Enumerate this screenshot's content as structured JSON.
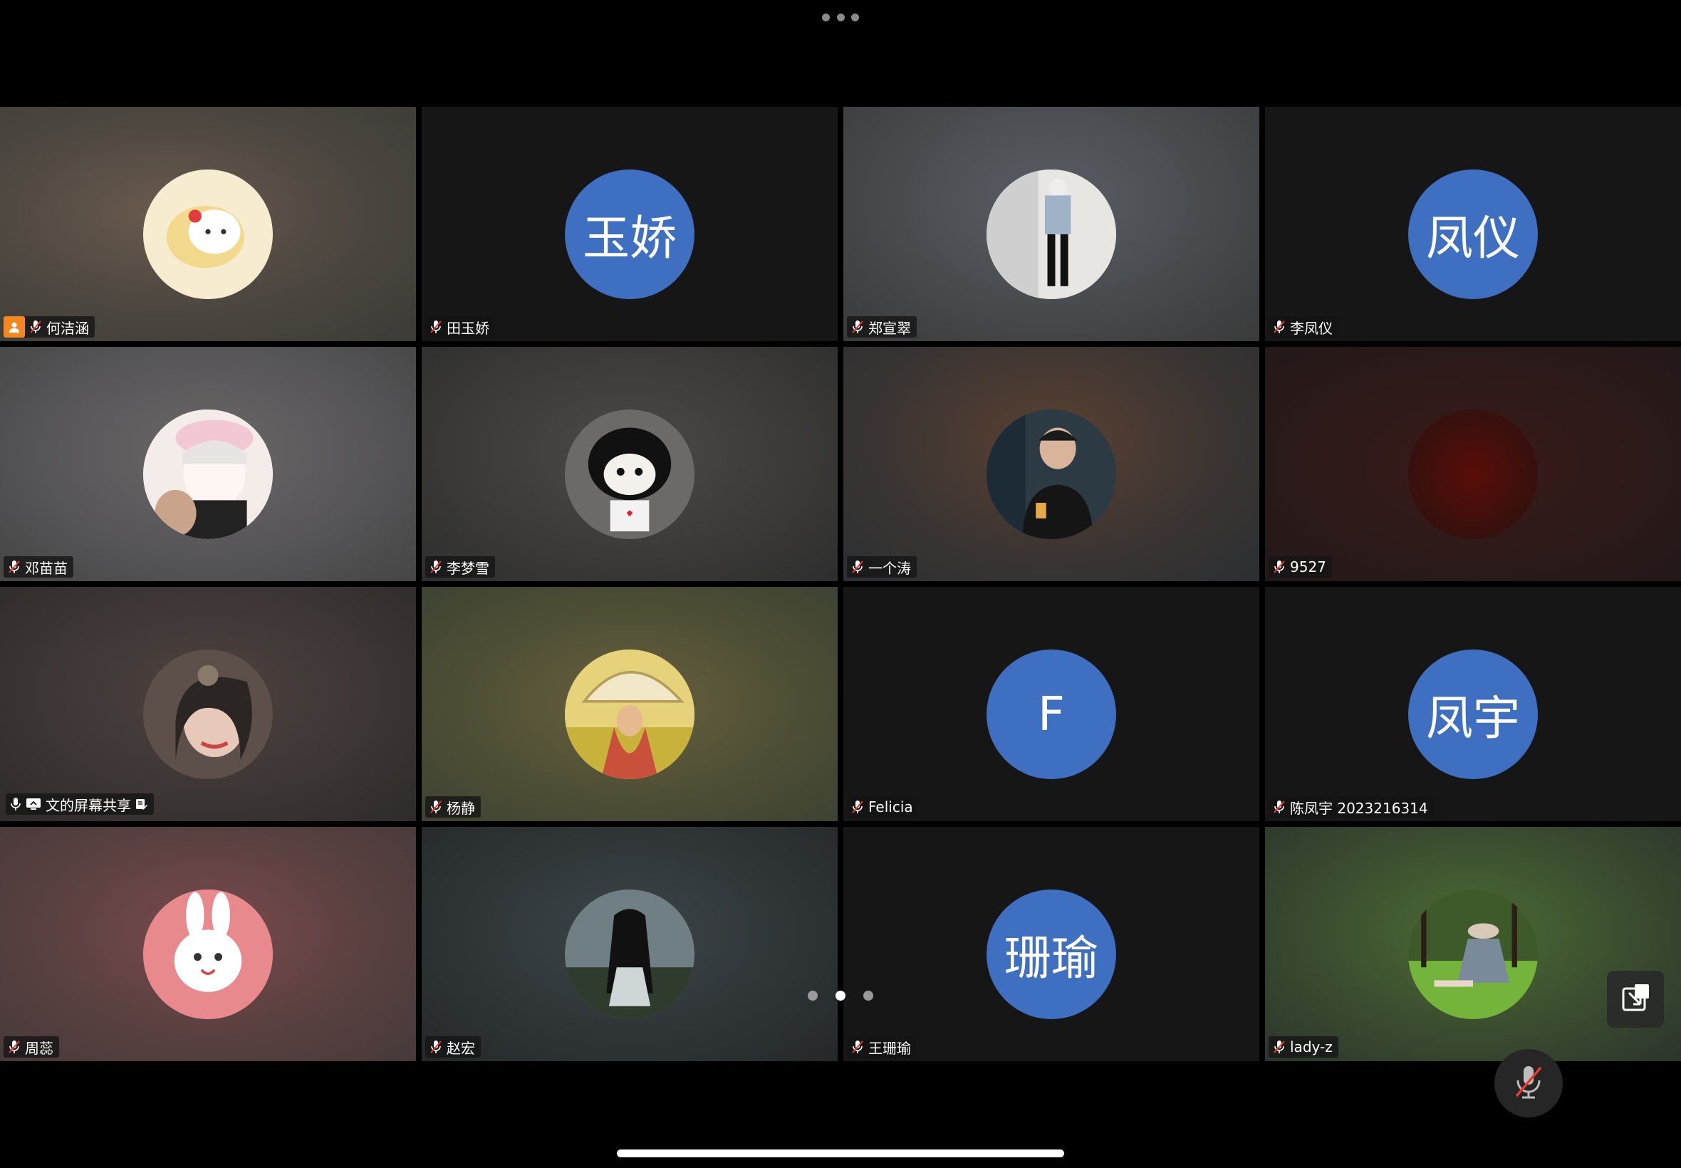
{
  "window": {
    "title": ""
  },
  "pager": {
    "pages": 3,
    "current": 2
  },
  "colors": {
    "accent_active": "#1fc15c",
    "avatar_initials_bg": "#3f6fc0",
    "host_badge": "#f5871f"
  },
  "participants": [
    {
      "name": "何洁涵",
      "avatar": "photo",
      "host": true,
      "muted": true
    },
    {
      "name": "田玉娇",
      "avatar": "initials",
      "initials": "玉娇",
      "muted": true
    },
    {
      "name": "郑宣翠",
      "avatar": "photo",
      "muted": true
    },
    {
      "name": "李凤仪",
      "avatar": "initials",
      "initials": "凤仪",
      "muted": true
    },
    {
      "name": "邓苗苗",
      "avatar": "photo",
      "muted": true
    },
    {
      "name": "李梦雪",
      "avatar": "photo",
      "muted": true
    },
    {
      "name": "一个涛",
      "avatar": "photo",
      "muted": true
    },
    {
      "name": "9527",
      "avatar": "photo",
      "muted": true
    },
    {
      "name": "文的屏幕共享",
      "avatar": "photo",
      "muted": false,
      "sharing": true,
      "active_speaker": true
    },
    {
      "name": "杨静",
      "avatar": "photo",
      "muted": true
    },
    {
      "name": "Felicia",
      "avatar": "initials",
      "initials": "F",
      "muted": true
    },
    {
      "name": "陈凤宇 2023216314",
      "avatar": "initials",
      "initials": "凤宇",
      "muted": true
    },
    {
      "name": "周蕊",
      "avatar": "photo",
      "muted": true
    },
    {
      "name": "赵宏",
      "avatar": "photo",
      "muted": true
    },
    {
      "name": "王珊瑜",
      "avatar": "initials",
      "initials": "珊瑜",
      "muted": true
    },
    {
      "name": "lady-z",
      "avatar": "photo",
      "muted": true
    }
  ],
  "icons": {
    "more": "more-dots-icon",
    "mute": "mic-muted-icon",
    "mic": "mic-icon",
    "share": "screen-share-icon",
    "annotate": "annotate-icon",
    "host": "host-user-icon",
    "float": "floating-window-icon"
  }
}
